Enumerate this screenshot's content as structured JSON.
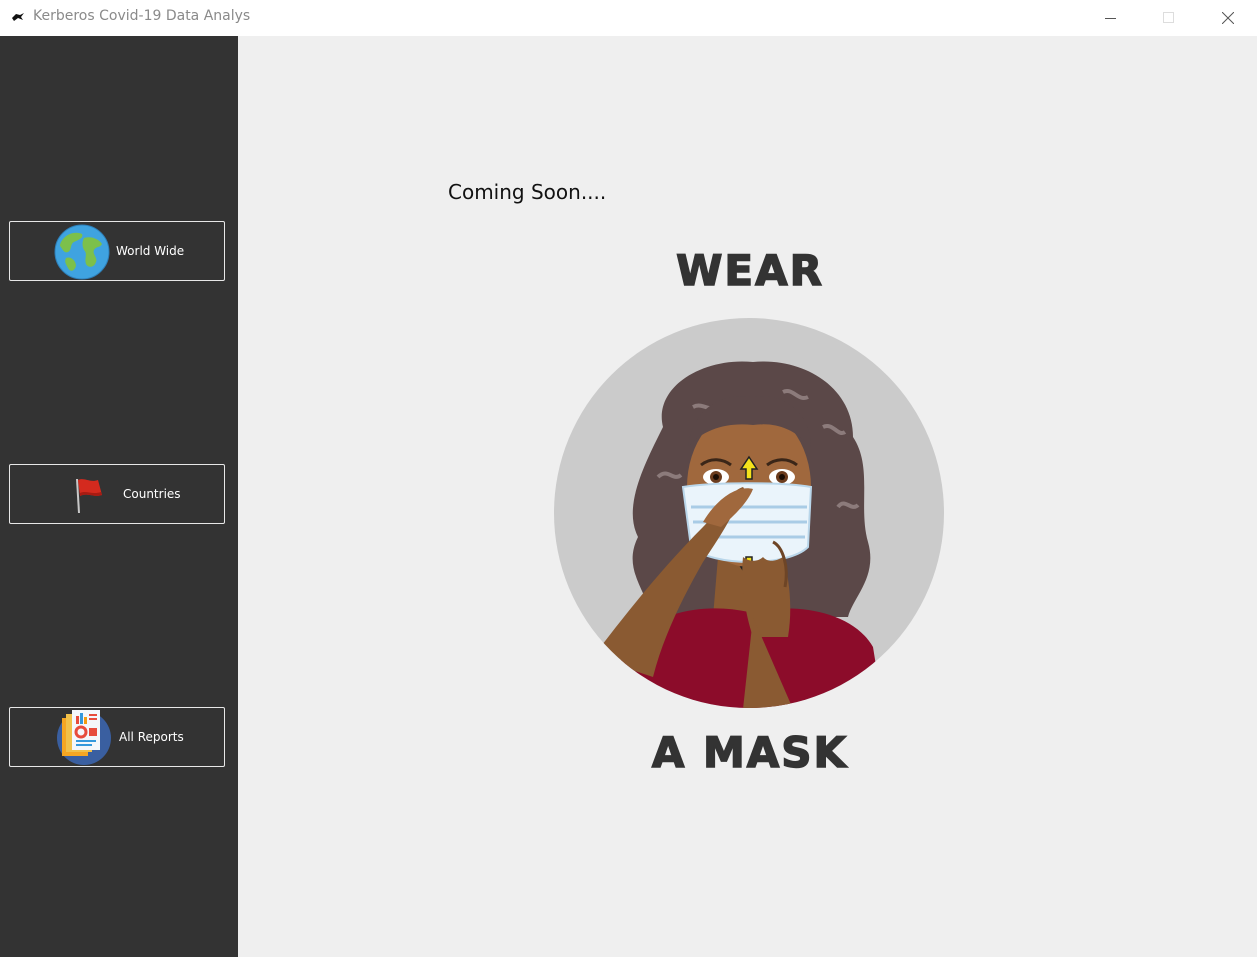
{
  "window": {
    "title": "Kerberos Covid-19 Data Analys",
    "icon": "kerberos-app-icon",
    "controls": [
      "minimize-icon",
      "maximize-icon",
      "close-icon"
    ]
  },
  "sidebar": {
    "background": "#333333",
    "items": [
      {
        "label": "World Wide",
        "icon": "globe-icon"
      },
      {
        "label": "Countries",
        "icon": "flag-icon"
      },
      {
        "label": "All Reports",
        "icon": "reports-icon"
      }
    ]
  },
  "main": {
    "background": "#efefef",
    "status_text": "Coming Soon....",
    "slogan_top": "WEAR",
    "slogan_bottom": "A MASK",
    "illustration": "woman-wearing-mask-illustration"
  }
}
